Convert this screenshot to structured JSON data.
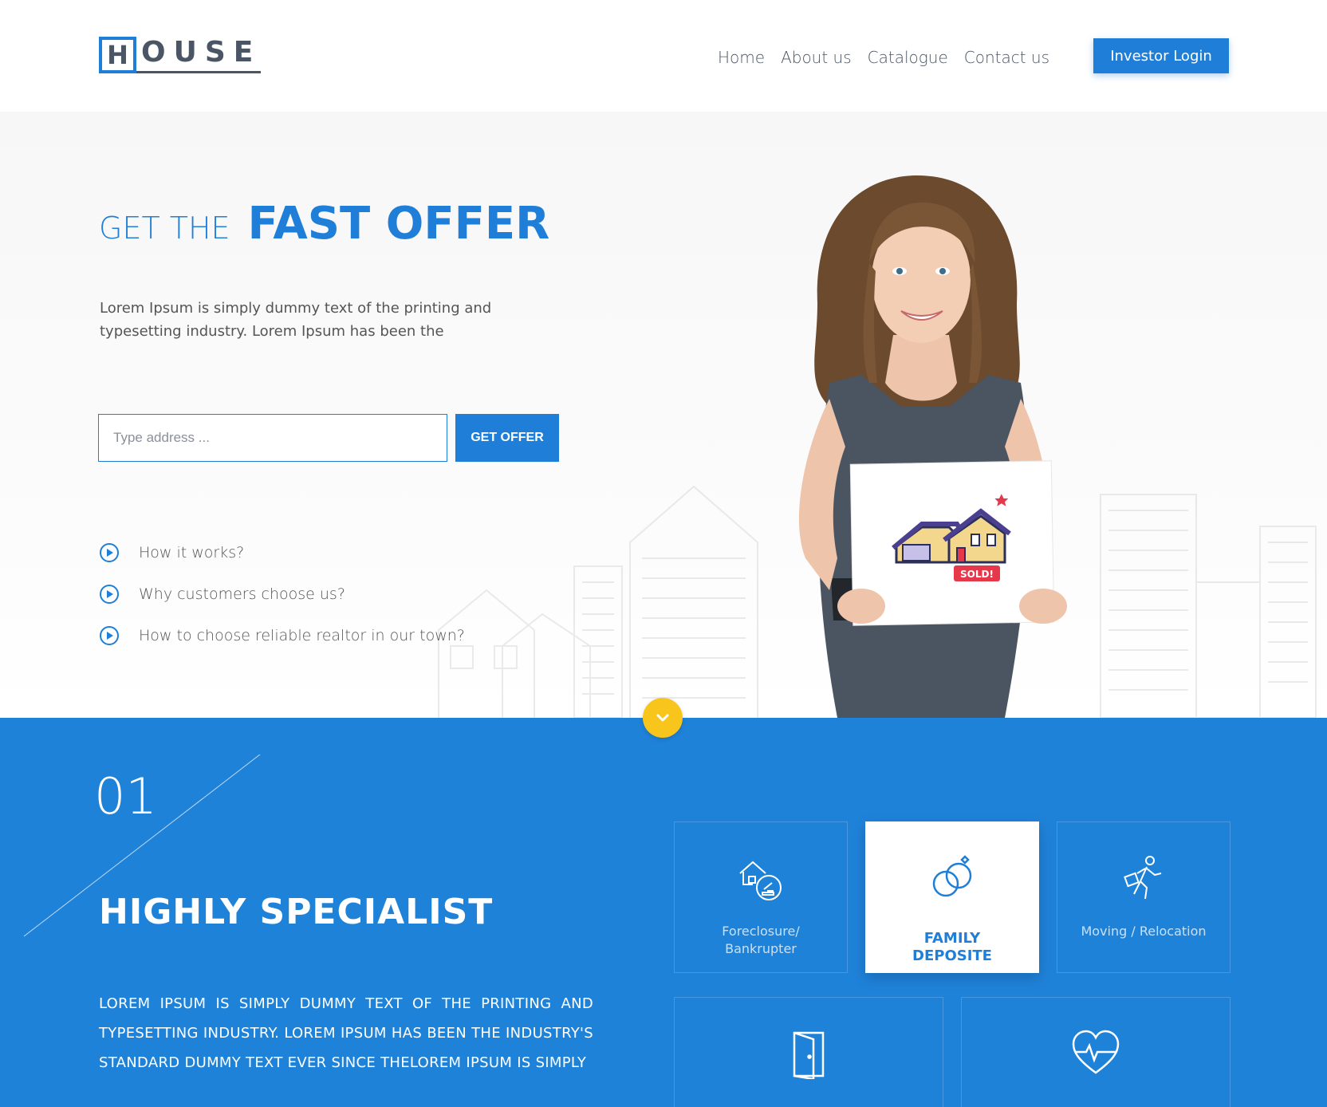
{
  "header": {
    "logo_first": "H",
    "logo_rest": "OUSE",
    "nav": [
      "Home",
      "About us",
      "Catalogue",
      "Contact us"
    ],
    "login_label": "Investor Login"
  },
  "hero": {
    "title_small": "GET THE",
    "title_big": "FAST OFFER",
    "description": "Lorem Ipsum is simply dummy text of the printing and typesetting industry. Lorem Ipsum has been the",
    "address_placeholder": "Type address ...",
    "offer_button": "GET OFFER",
    "faq": [
      "How it works?",
      "Why customers choose us?",
      "How to choose  reliable realtor in our town?"
    ],
    "sign_text": "SOLD!"
  },
  "section": {
    "number": "01",
    "title": "HIGHLY SPECIALIST",
    "description": "Lorem Ipsum is simply dummy text of the printing and typesetting industry. Lorem Ipsum has been the industry's standard dummy text ever since theLorem Ipsum is simply",
    "cards": [
      {
        "label": "Foreclosure/ Bankrupter",
        "icon": "house-gavel-icon"
      },
      {
        "label": "FAMILY DEPOSITE",
        "icon": "rings-icon"
      },
      {
        "label": "Moving / Relocation",
        "icon": "running-man-icon"
      },
      {
        "label": "",
        "icon": "door-icon"
      },
      {
        "label": "",
        "icon": "heartbeat-icon"
      }
    ]
  },
  "colors": {
    "accent": "#1f7fd8",
    "section_bg": "#1f82d9",
    "scroll_button": "#f8c51c"
  }
}
